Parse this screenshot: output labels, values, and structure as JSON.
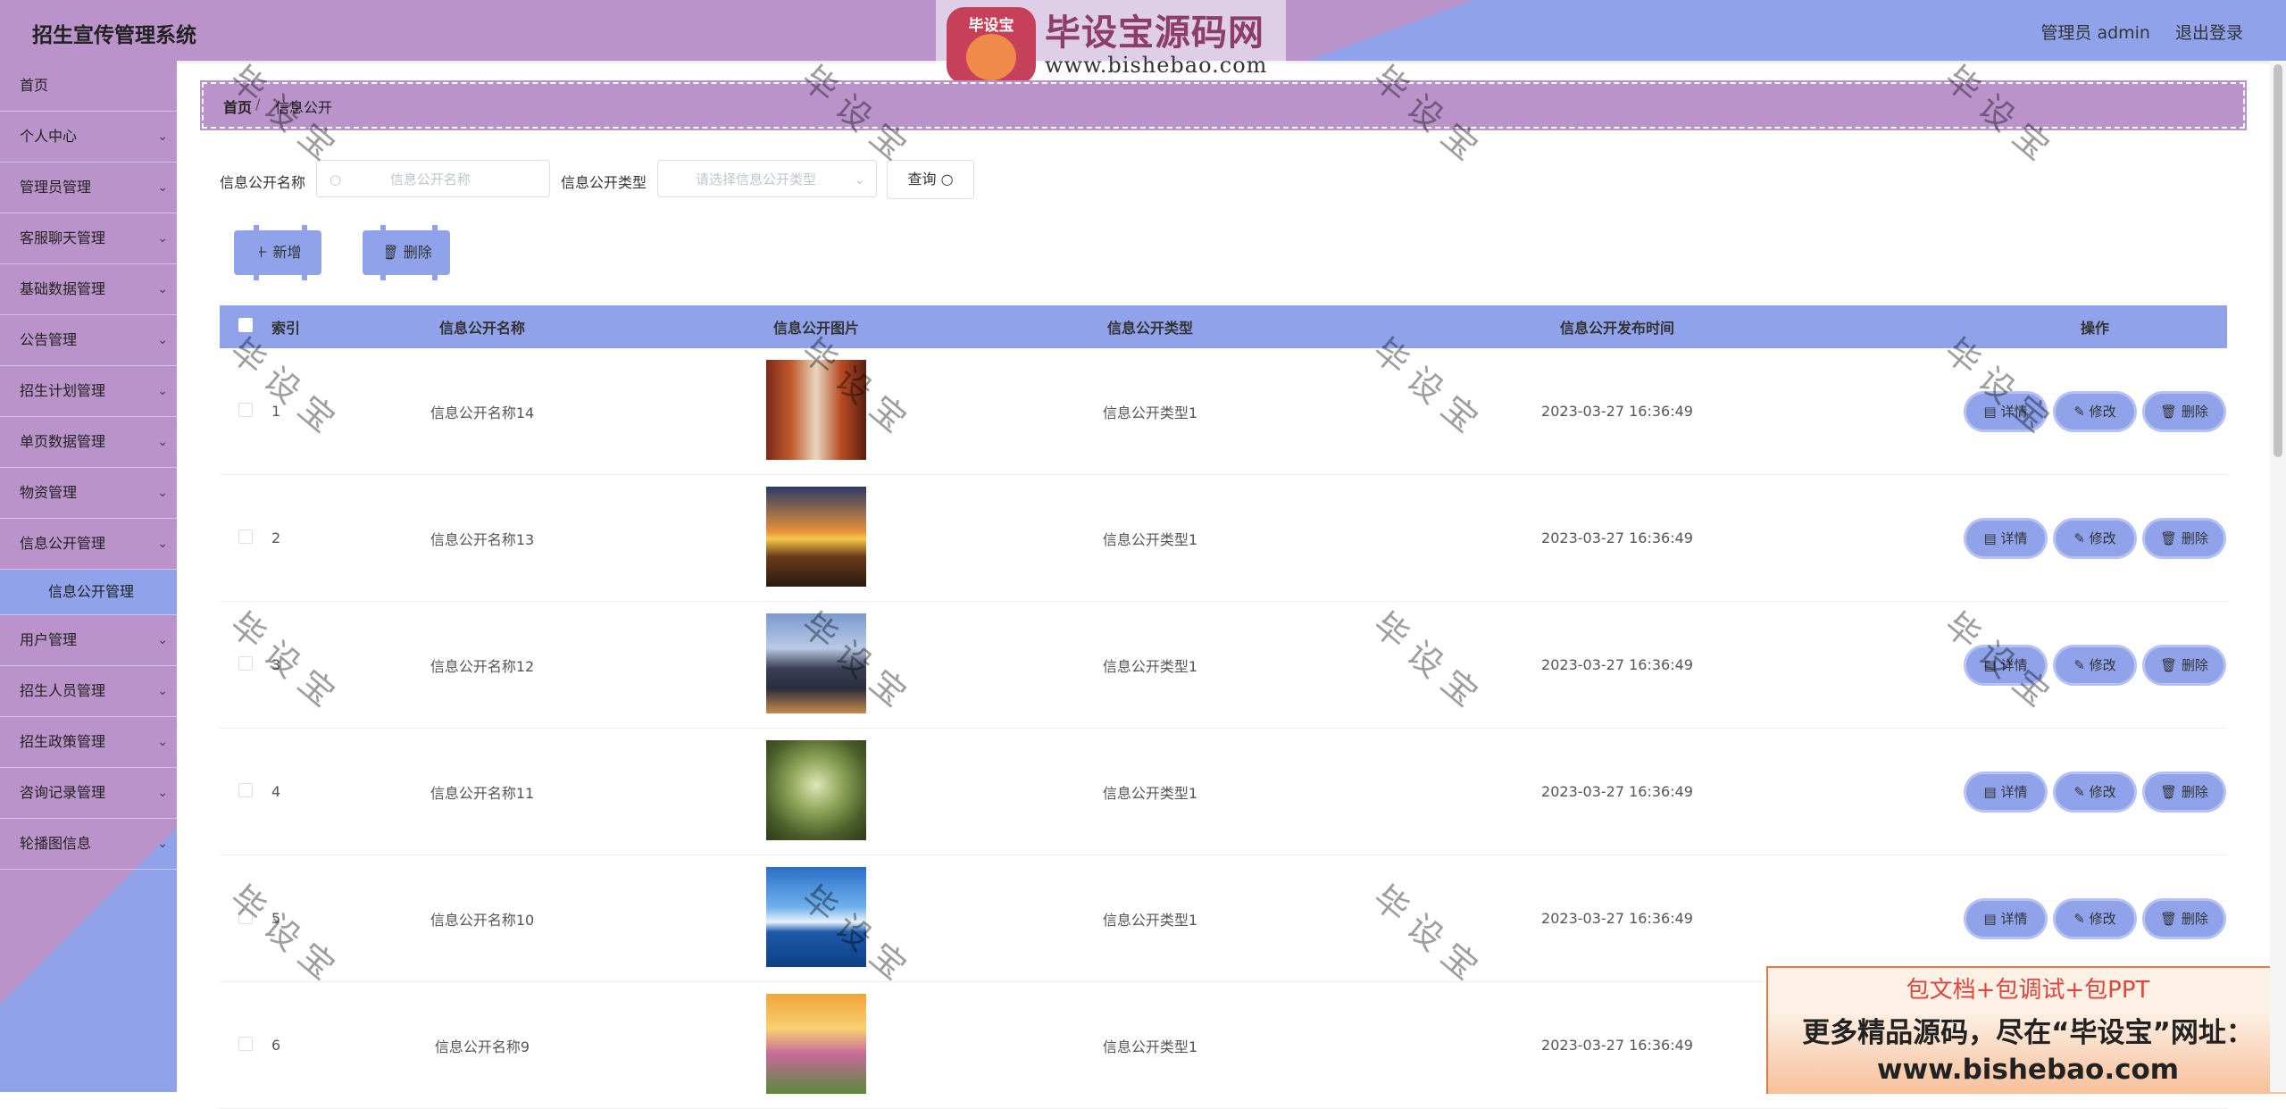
{
  "header": {
    "title": "招生宣传管理系统",
    "user_label": "管理员 admin",
    "logout": "退出登录",
    "logo_badge": "毕设宝",
    "logo_text": "毕设宝源码网",
    "logo_url": "www.bishebao.com"
  },
  "sidebar": {
    "items": [
      {
        "label": "首页",
        "arrow": false
      },
      {
        "label": "个人中心",
        "arrow": true
      },
      {
        "label": "管理员管理",
        "arrow": true
      },
      {
        "label": "客服聊天管理",
        "arrow": true
      },
      {
        "label": "基础数据管理",
        "arrow": true
      },
      {
        "label": "公告管理",
        "arrow": true
      },
      {
        "label": "招生计划管理",
        "arrow": true
      },
      {
        "label": "单页数据管理",
        "arrow": true
      },
      {
        "label": "物资管理",
        "arrow": true
      },
      {
        "label": "信息公开管理",
        "arrow": true,
        "sub": "信息公开管理"
      },
      {
        "label": "用户管理",
        "arrow": true
      },
      {
        "label": "招生人员管理",
        "arrow": true
      },
      {
        "label": "招生政策管理",
        "arrow": true
      },
      {
        "label": "咨询记录管理",
        "arrow": true
      },
      {
        "label": "轮播图信息",
        "arrow": true
      }
    ]
  },
  "breadcrumb": {
    "home": "首页",
    "current": "信息公开"
  },
  "search": {
    "name_label": "信息公开名称",
    "name_placeholder": "信息公开名称",
    "type_label": "信息公开类型",
    "type_placeholder": "请选择信息公开类型",
    "query_label": "查询"
  },
  "actions": {
    "add_label": "新增",
    "delete_label": "删除"
  },
  "table": {
    "columns": [
      "索引",
      "信息公开名称",
      "信息公开图片",
      "信息公开类型",
      "信息公开发布时间",
      "操作"
    ],
    "rows": [
      {
        "index": "1",
        "name": "信息公开名称14",
        "type": "信息公开类型1",
        "time": "2023-03-27 16:36:49",
        "img": "corridor"
      },
      {
        "index": "2",
        "name": "信息公开名称13",
        "type": "信息公开类型1",
        "time": "2023-03-27 16:36:49",
        "img": "sunset-road"
      },
      {
        "index": "3",
        "name": "信息公开名称12",
        "type": "信息公开类型1",
        "time": "2023-03-27 16:36:49",
        "img": "mountain-city"
      },
      {
        "index": "4",
        "name": "信息公开名称11",
        "type": "信息公开类型1",
        "time": "2023-03-27 16:36:49",
        "img": "forest-path"
      },
      {
        "index": "5",
        "name": "信息公开名称10",
        "type": "信息公开类型1",
        "time": "2023-03-27 16:36:49",
        "img": "sea-sky"
      },
      {
        "index": "6",
        "name": "信息公开名称9",
        "type": "信息公开类型1",
        "time": "2023-03-27 16:36:49",
        "img": "flower-field"
      }
    ],
    "op_detail": "详情",
    "op_edit": "修改",
    "op_delete": "删除"
  },
  "watermark": "毕设宝",
  "promo": {
    "line1": "包文档+包调试+包PPT",
    "line2": "更多精品源码，尽在“毕设宝”网址：",
    "line3": "www.bishebao.com"
  },
  "colors": {
    "purple": "#b993c9",
    "blue": "#8fa2ea"
  }
}
